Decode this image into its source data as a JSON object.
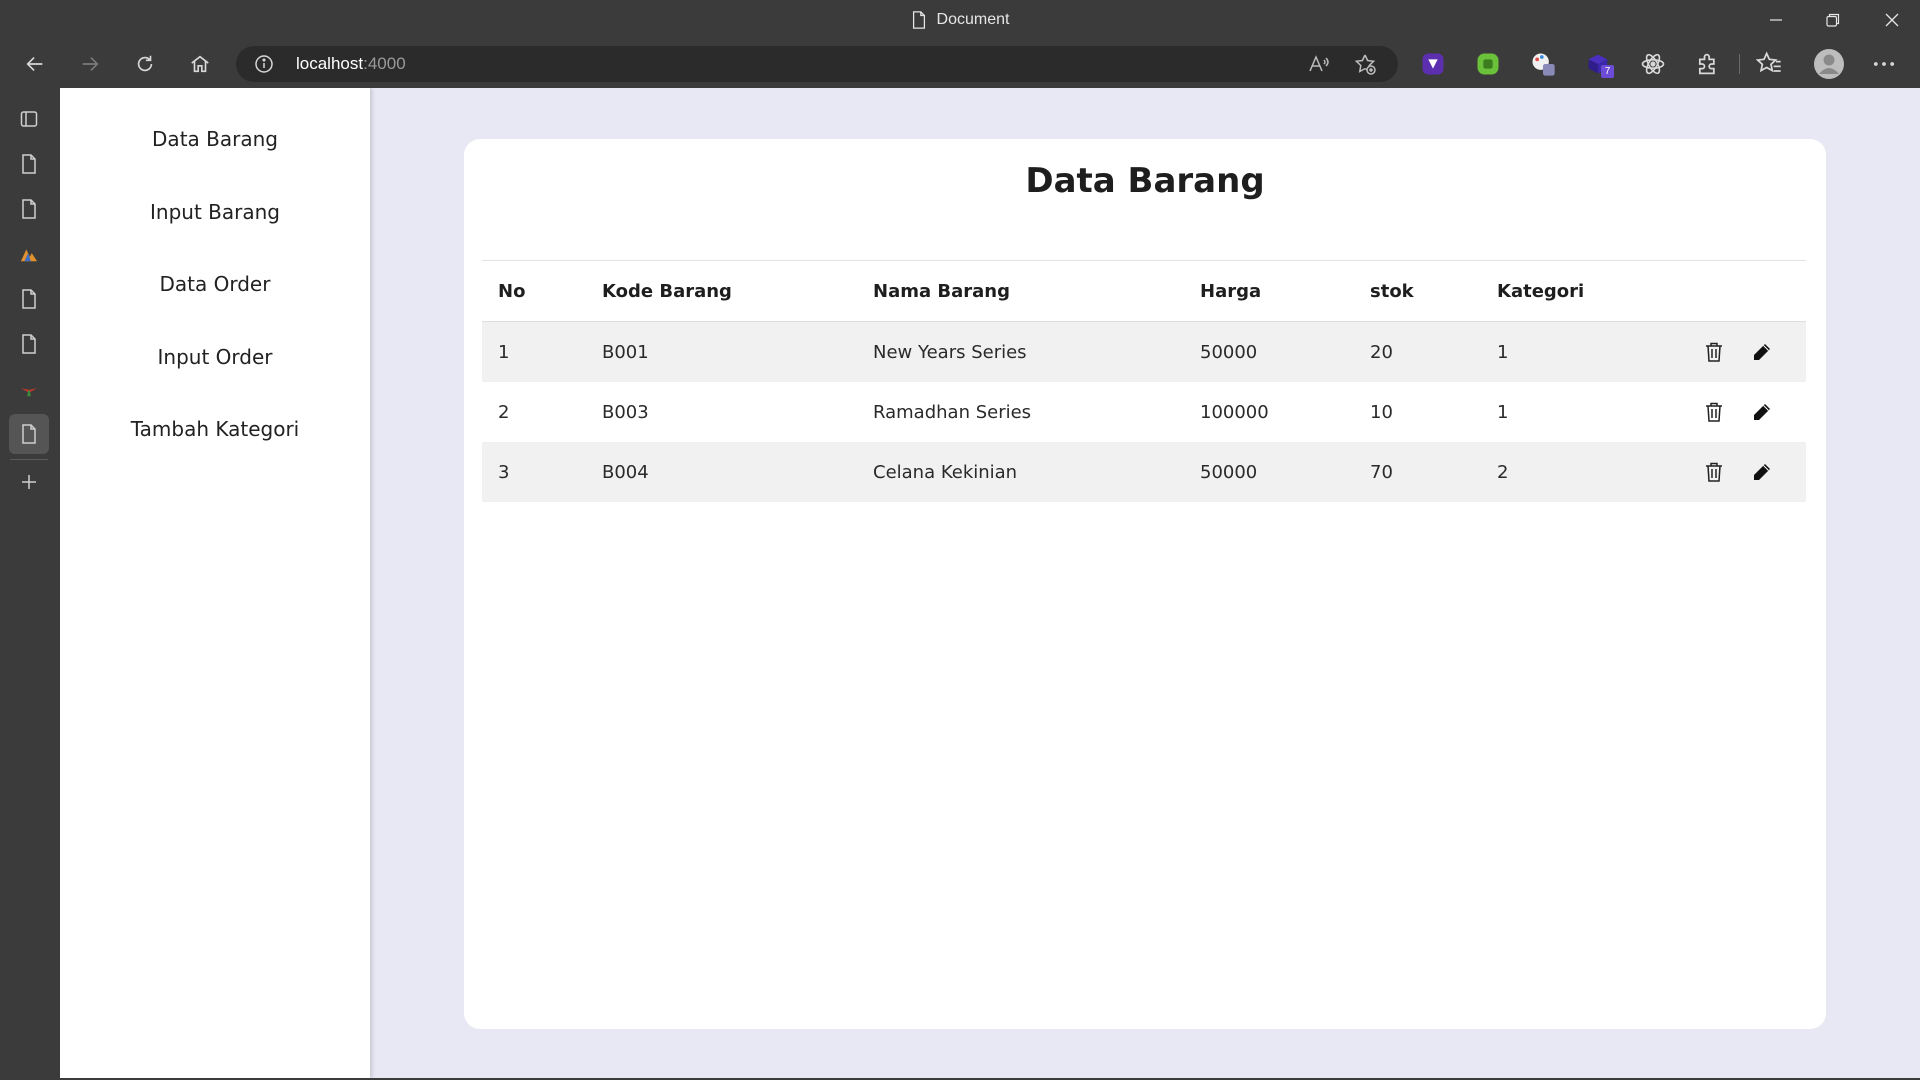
{
  "window": {
    "title": "Document"
  },
  "address_bar": {
    "host": "localhost",
    "port": ":4000"
  },
  "extensions": {
    "badge_count": "7"
  },
  "sidebar": {
    "items": [
      {
        "label": "Data Barang"
      },
      {
        "label": "Input Barang"
      },
      {
        "label": "Data Order"
      },
      {
        "label": "Input Order"
      },
      {
        "label": "Tambah Kategori"
      }
    ]
  },
  "main": {
    "title": "Data Barang",
    "table": {
      "headers": [
        "No",
        "Kode Barang",
        "Nama Barang",
        "Harga",
        "stok",
        "Kategori"
      ],
      "rows": [
        [
          "1",
          "B001",
          "New Years Series",
          "50000",
          "20",
          "1"
        ],
        [
          "2",
          "B003",
          "Ramadhan Series",
          "100000",
          "10",
          "1"
        ],
        [
          "3",
          "B004",
          "Celana Kekinian",
          "50000",
          "70",
          "2"
        ]
      ]
    }
  },
  "colors": {
    "browser_chrome": "#3b3b3b",
    "page_background": "#e8e8f4",
    "card": "#ffffff",
    "stripe": "#f1f1f1"
  }
}
